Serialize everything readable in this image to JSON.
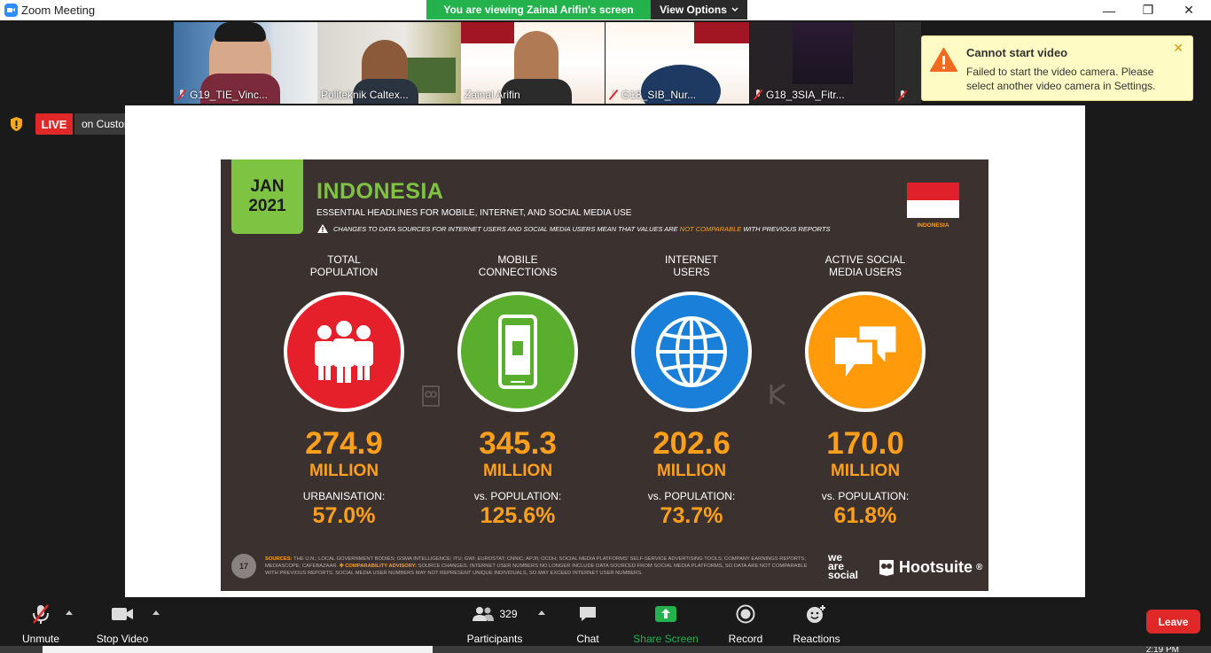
{
  "window": {
    "title": "Zoom Meeting",
    "minimize": "—",
    "restore": "❐",
    "close": "✕"
  },
  "share_banner": {
    "text": "You are viewing Zainal Arifin's screen",
    "view_options": "View Options",
    "colors": {
      "banner": "#23b24b"
    }
  },
  "participants_strip": [
    {
      "name": "G19_TIE_Vinc...",
      "muted": true
    },
    {
      "name": "Politeknik Caltex...",
      "muted": false
    },
    {
      "name": "Zainal Arifin",
      "muted": false
    },
    {
      "name": "G18_SIB_Nur...",
      "muted": true
    },
    {
      "name": "G18_3SIA_Fitr...",
      "muted": true
    },
    {
      "name": "",
      "muted": true
    }
  ],
  "toast": {
    "title": "Cannot start video",
    "body": "Failed to start the video camera. Please select another video camera in Settings.",
    "close": "✕"
  },
  "live": {
    "badge": "LIVE",
    "service": "on Custom Live Streaming Service"
  },
  "slide": {
    "month": "JAN",
    "year": "2021",
    "title": "INDONESIA",
    "subtitle": "ESSENTIAL HEADLINES FOR MOBILE, INTERNET, AND SOCIAL MEDIA USE",
    "warning_pre": "CHANGES TO DATA SOURCES FOR INTERNET USERS AND SOCIAL MEDIA USERS MEAN THAT VALUES ARE",
    "warning_nc": "NOT COMPARABLE",
    "warning_post": "WITH PREVIOUS REPORTS",
    "flag_label": "INDONESIA",
    "stats": [
      {
        "label": "TOTAL\nPOPULATION",
        "value": "274.9",
        "unit": "MILLION",
        "sub_label": "URBANISATION:",
        "sub_value": "57.0%",
        "color": "#e5202a",
        "icon": "people-icon"
      },
      {
        "label": "MOBILE\nCONNECTIONS",
        "value": "345.3",
        "unit": "MILLION",
        "sub_label": "vs. POPULATION:",
        "sub_value": "125.6%",
        "color": "#5aae2e",
        "icon": "mobile-phone-icon"
      },
      {
        "label": "INTERNET\nUSERS",
        "value": "202.6",
        "unit": "MILLION",
        "sub_label": "vs. POPULATION:",
        "sub_value": "73.7%",
        "color": "#1a7fd8",
        "icon": "globe-icon"
      },
      {
        "label": "ACTIVE SOCIAL\nMEDIA USERS",
        "value": "170.0",
        "unit": "MILLION",
        "sub_label": "vs. POPULATION:",
        "sub_value": "61.8%",
        "color": "#ff9a0a",
        "icon": "chat-bubbles-icon"
      }
    ],
    "page_number": "17",
    "sources_label": "SOURCES:",
    "sources_text": "THE U.N.; LOCAL GOVERNMENT BODIES; GSMA INTELLIGENCE; ITU; GWI; EUROSTAT; CNNIC; APJII; OCDH; SOCIAL MEDIA PLATFORMS' SELF-SERVICE ADVERTISING TOOLS; COMPANY EARNINGS REPORTS; MEDIASCOPE; CAFEBAZAAR.",
    "advisory_label": "✚ COMPARABILITY ADVISORY:",
    "advisory_text": "SOURCE CHANGES. INTERNET USER NUMBERS NO LONGER INCLUDE DATA SOURCED FROM SOCIAL MEDIA PLATFORMS, SO DATA ARE NOT COMPARABLE WITH PREVIOUS REPORTS. SOCIAL MEDIA USER NUMBERS MAY NOT REPRESENT UNIQUE INDIVIDUALS, SO MAY EXCEED INTERNET USER NUMBERS.",
    "brand_we": "we",
    "brand_are": "are",
    "brand_social": "social",
    "brand_hootsuite": "Hootsuite",
    "brand_registered": "®"
  },
  "toolbar": {
    "unmute": "Unmute",
    "stop_video": "Stop Video",
    "participants": "Participants",
    "participants_count": "329",
    "chat": "Chat",
    "share_screen": "Share Screen",
    "record": "Record",
    "reactions": "Reactions",
    "leave": "Leave"
  },
  "clock": "2:19 PM",
  "colors": {
    "leave": "#e02828",
    "live": "#e02828",
    "share_green": "#23b24b",
    "accent_orange": "#ff9f1a"
  }
}
